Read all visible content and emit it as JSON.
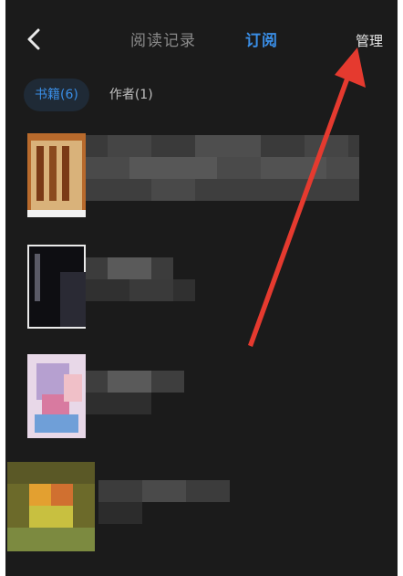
{
  "header": {
    "tabs": [
      {
        "label": "阅读记录",
        "active": false
      },
      {
        "label": "订阅",
        "active": true
      }
    ],
    "manage_label": "管理"
  },
  "filters": [
    {
      "label": "书籍(6)",
      "active": true
    },
    {
      "label": "作者(1)",
      "active": false
    }
  ],
  "colors": {
    "accent": "#3a8ee6",
    "background": "#1b1b1b",
    "annotation_arrow": "#e53a2f"
  },
  "icons": [
    "back-arrow-icon"
  ]
}
